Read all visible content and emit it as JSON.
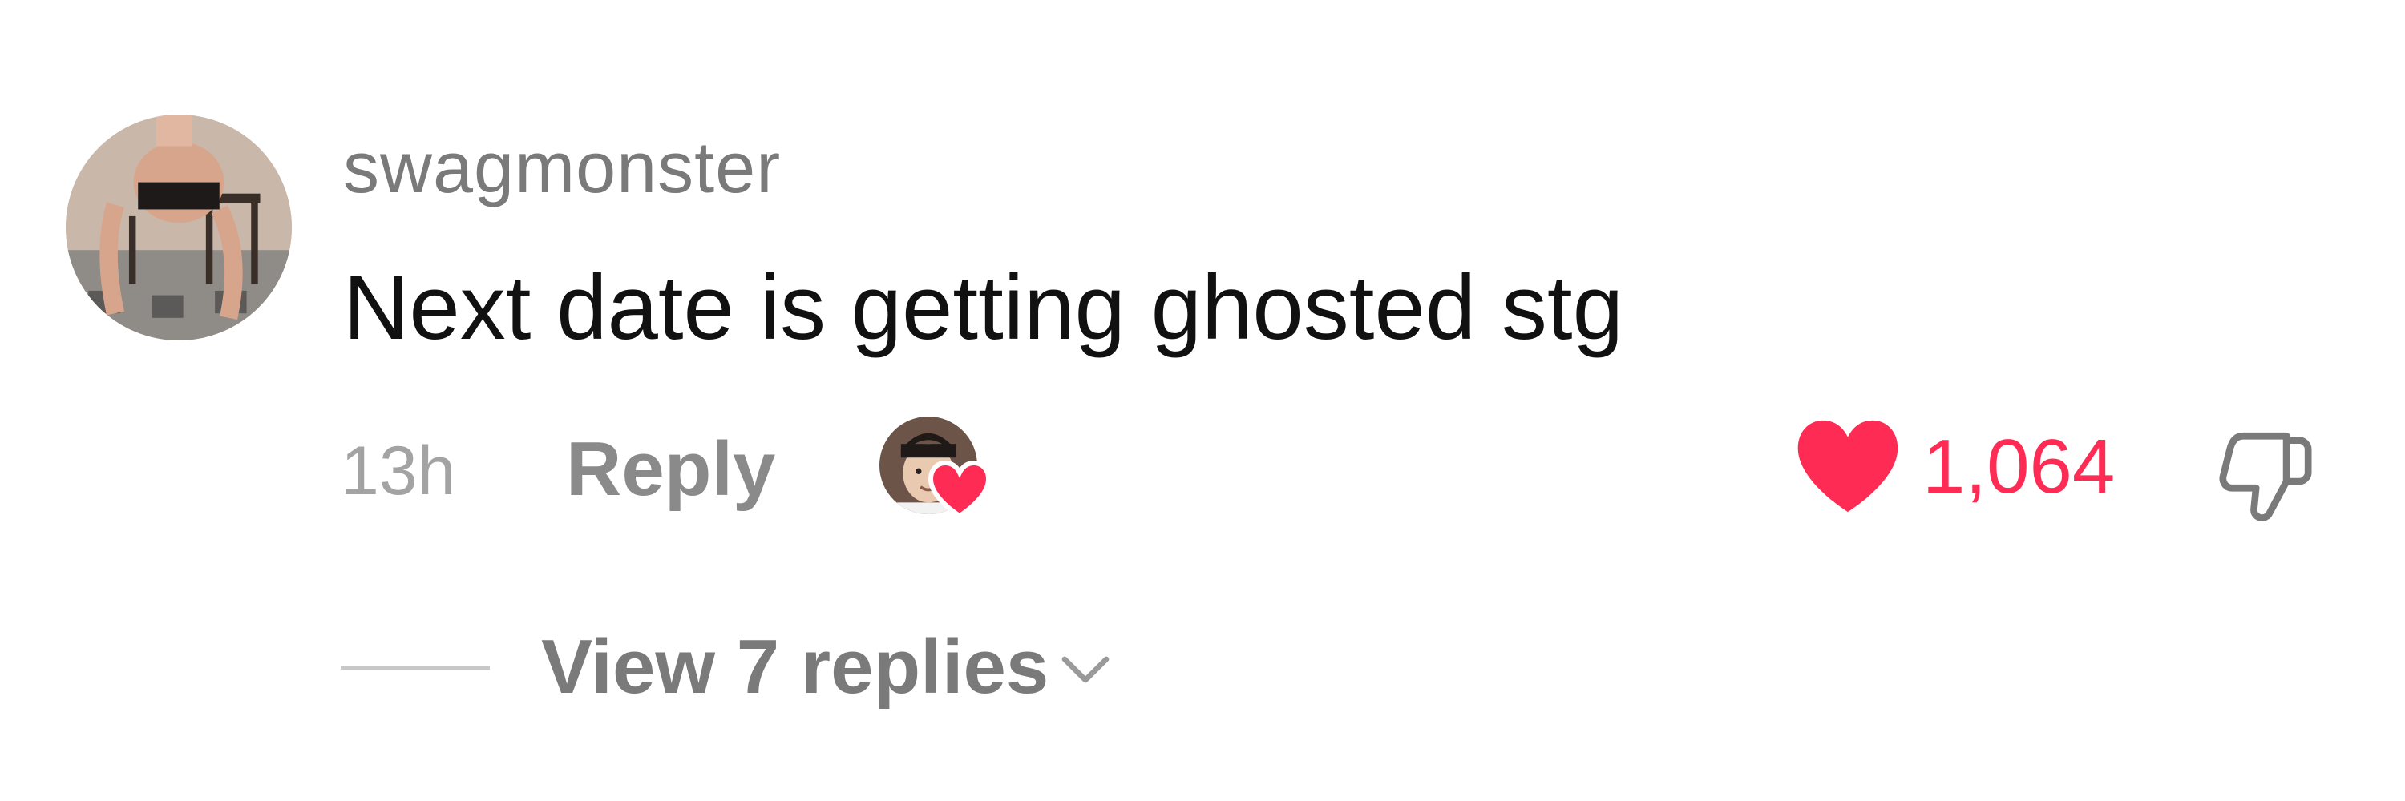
{
  "comment": {
    "username": "swagmonster",
    "text": "Next date is getting ghosted stg",
    "timestamp": "13h",
    "reply_label": "Reply",
    "like_count": "1,064",
    "liked": true,
    "liked_by_creator": true,
    "avatar_icon": "user-avatar-photo",
    "creator_avatar_icon": "creator-avatar-photo"
  },
  "replies": {
    "label": "View 7 replies"
  },
  "colors": {
    "like_accent": "#fe2c55",
    "username": "#7a7a7a",
    "comment_text": "#111111",
    "muted": "#a3a3a3"
  }
}
